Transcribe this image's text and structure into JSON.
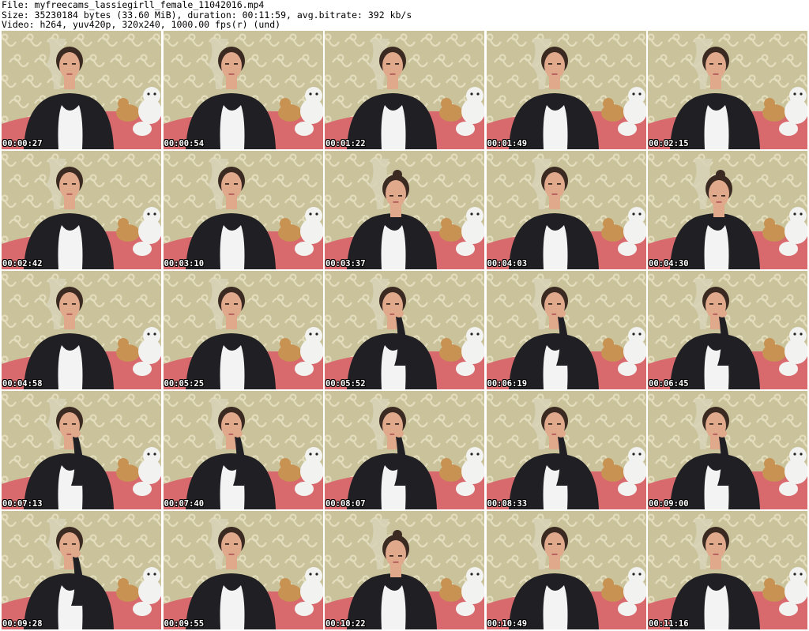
{
  "header": {
    "line1": "File: myfreecams_lassiegirll_female_11042016.mp4",
    "line2": "Size: 35230184 bytes (33.60 MiB), duration: 00:11:59, avg.bitrate: 392 kb/s",
    "line3": "Video: h264, yuv420p, 320x240, 1000.00 fps(r) (und)"
  },
  "colors": {
    "wall": "#c9c29a",
    "wall_pattern": "#e6e1c2",
    "bed": "#d86a6e",
    "hoodie": "#1f1f24",
    "shirt": "#f3f3f3",
    "skin": "#e0a98c",
    "hair": "#3a2a22",
    "toy_white": "#f2f2f0",
    "toy_brown": "#c89252"
  },
  "frames": [
    {
      "time": "00:00:27",
      "pose": "center"
    },
    {
      "time": "00:00:54",
      "pose": "center"
    },
    {
      "time": "00:01:22",
      "pose": "center"
    },
    {
      "time": "00:01:49",
      "pose": "center"
    },
    {
      "time": "00:02:15",
      "pose": "center"
    },
    {
      "time": "00:02:42",
      "pose": "center"
    },
    {
      "time": "00:03:10",
      "pose": "center"
    },
    {
      "time": "00:03:37",
      "pose": "down"
    },
    {
      "time": "00:04:03",
      "pose": "center"
    },
    {
      "time": "00:04:30",
      "pose": "down"
    },
    {
      "time": "00:04:58",
      "pose": "center"
    },
    {
      "time": "00:05:25",
      "pose": "center"
    },
    {
      "time": "00:05:52",
      "pose": "hand"
    },
    {
      "time": "00:06:19",
      "pose": "hand"
    },
    {
      "time": "00:06:45",
      "pose": "hand"
    },
    {
      "time": "00:07:13",
      "pose": "hand"
    },
    {
      "time": "00:07:40",
      "pose": "hand"
    },
    {
      "time": "00:08:07",
      "pose": "hand"
    },
    {
      "time": "00:08:33",
      "pose": "hand"
    },
    {
      "time": "00:09:00",
      "pose": "hand"
    },
    {
      "time": "00:09:28",
      "pose": "hand"
    },
    {
      "time": "00:09:55",
      "pose": "center"
    },
    {
      "time": "00:10:22",
      "pose": "down"
    },
    {
      "time": "00:10:49",
      "pose": "center"
    },
    {
      "time": "00:11:16",
      "pose": "center"
    }
  ]
}
